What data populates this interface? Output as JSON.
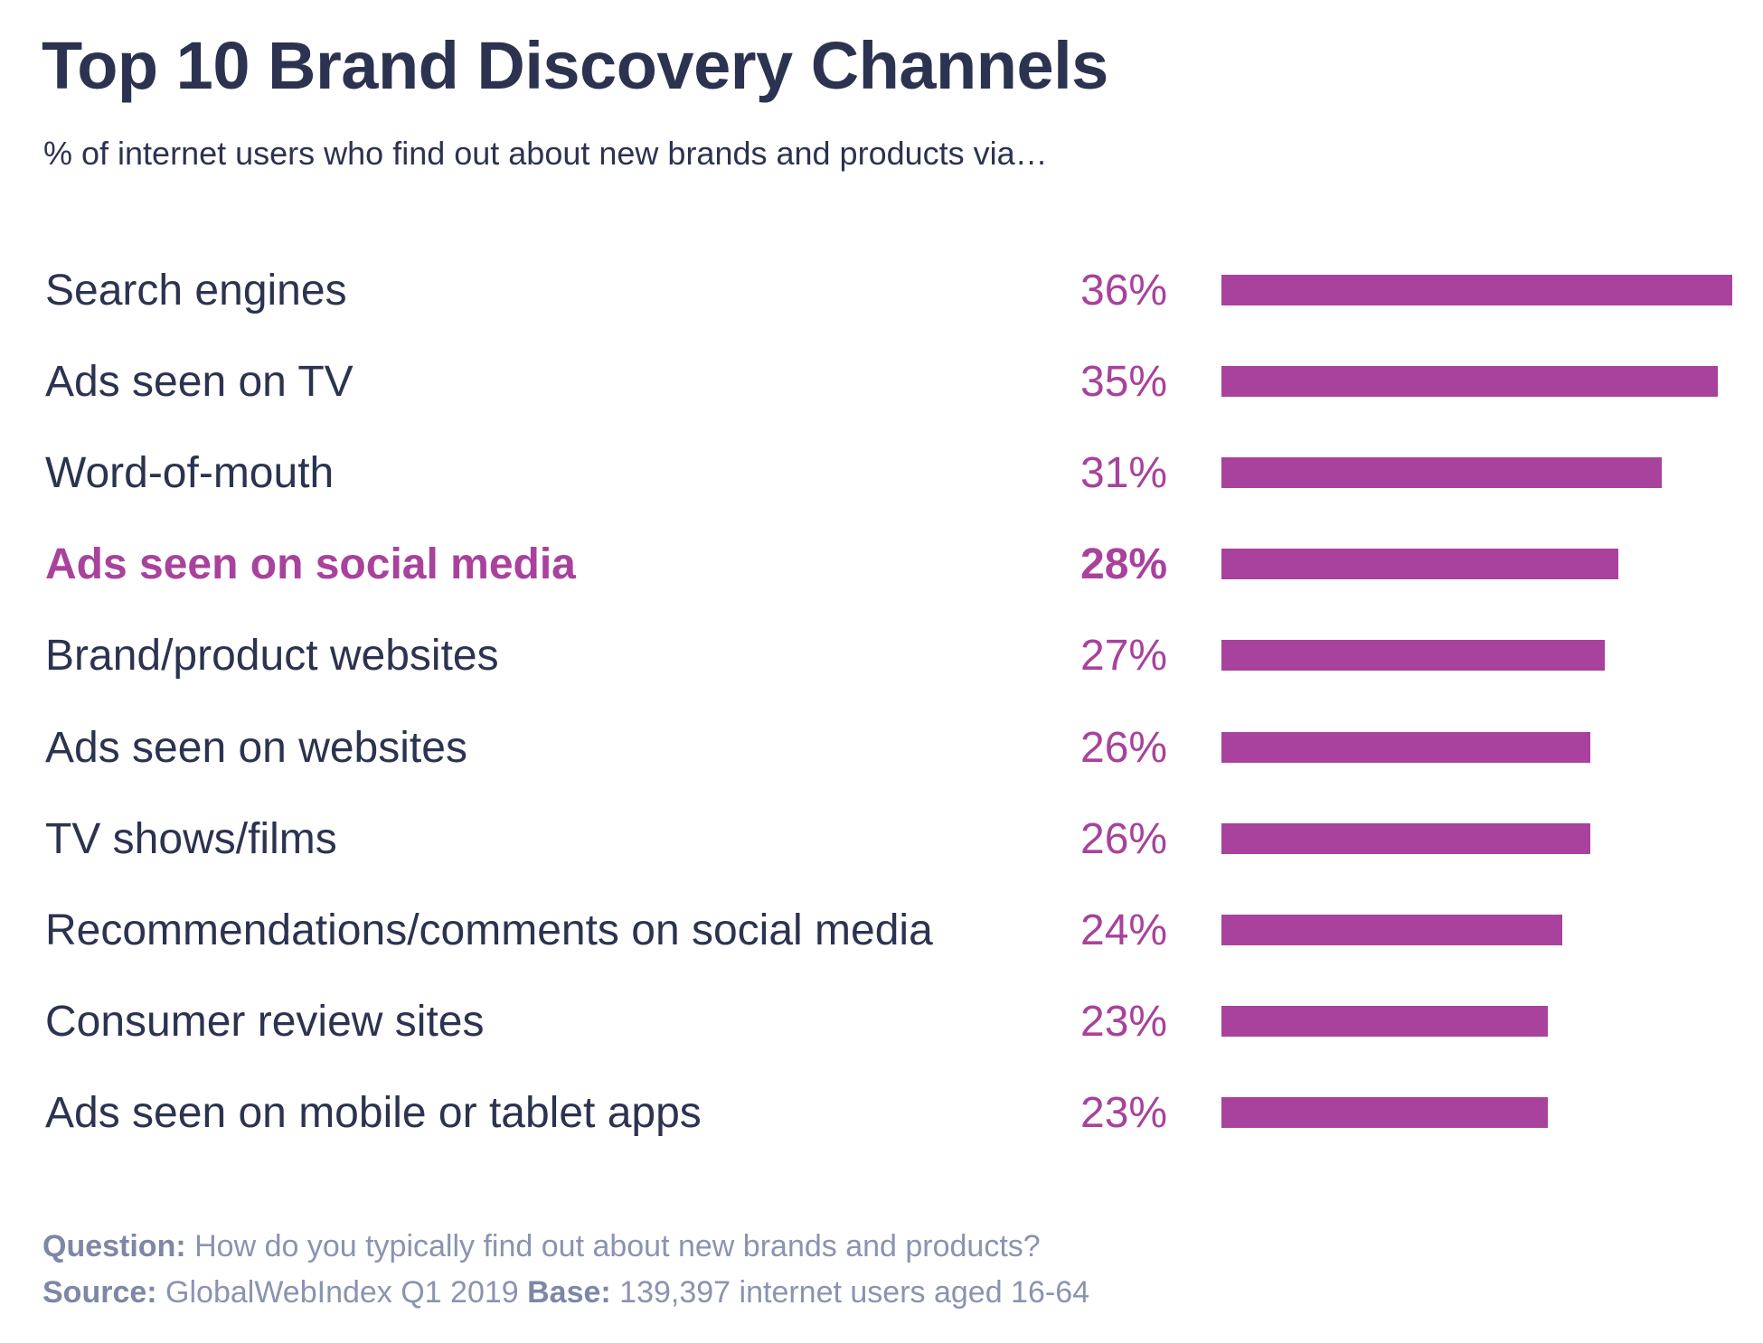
{
  "chart_data": {
    "type": "bar",
    "orientation": "horizontal",
    "title": "Top 10 Brand Discovery Channels",
    "subtitle": "% of internet users who find out about new brands and products via…",
    "xlabel": "",
    "ylabel": "",
    "xlim": [
      0,
      36
    ],
    "grid": false,
    "legend": "none",
    "value_suffix": "%",
    "bar_color": "#a8429c",
    "highlight_color": "#a8429c",
    "text_color": "#2b3350",
    "categories": [
      "Search engines",
      "Ads seen on TV",
      "Word-of-mouth",
      "Ads seen on social media",
      "Brand/product websites",
      "Ads seen on websites",
      "TV shows/films",
      "Recommendations/comments on social media",
      "Consumer review sites",
      "Ads seen on mobile or tablet apps"
    ],
    "values": [
      36,
      35,
      31,
      28,
      27,
      26,
      26,
      24,
      23,
      23
    ],
    "value_labels": [
      "36%",
      "35%",
      "31%",
      "28%",
      "27%",
      "26%",
      "26%",
      "24%",
      "23%",
      "23%"
    ],
    "highlighted": [
      "Ads seen on social media"
    ]
  },
  "footer": {
    "question_label": "Question:",
    "question_text": " How do you typically find out about new brands and products?",
    "source_label": "Source:",
    "source_text": " GlobalWebIndex Q1 2019 ",
    "base_label": "Base:",
    "base_text": " 139,397 internet users aged 16-64"
  }
}
